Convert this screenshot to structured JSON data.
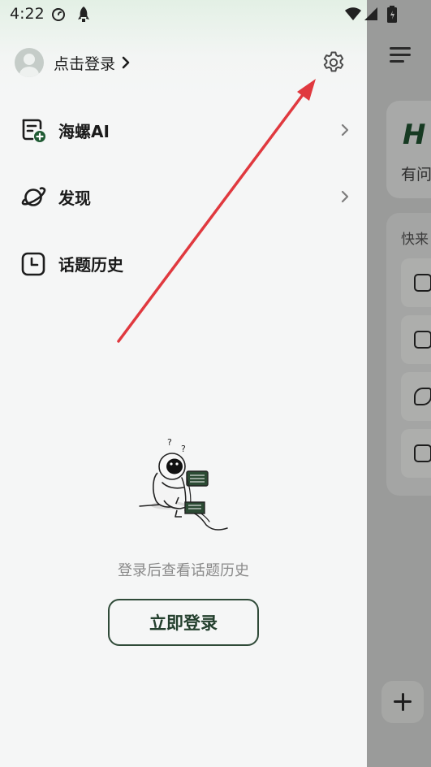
{
  "status_bar": {
    "time": "4:22",
    "icons": [
      "notification-swirl-icon",
      "rocket-icon",
      "wifi-icon",
      "signal-icon",
      "battery-icon"
    ]
  },
  "drawer": {
    "profile": {
      "login_prompt": "点击登录",
      "avatar_icon": "default-avatar-icon",
      "settings_icon": "gear-icon"
    },
    "menu_items": [
      {
        "label": "海螺AI",
        "icon": "chat-plus-icon",
        "has_chevron": true
      },
      {
        "label": "发现",
        "icon": "planet-icon",
        "has_chevron": true
      },
      {
        "label": "话题历史",
        "icon": "clock-icon",
        "has_chevron": false
      }
    ],
    "empty_state": {
      "illustration": "astronaut-reading-illustration",
      "message": "登录后查看话题历史",
      "login_button": "立即登录"
    }
  },
  "background_app": {
    "menu_icon": "hamburger-menu-icon",
    "logo_fragment": "H",
    "subtitle_fragment": "有问",
    "quick_section_fragment": "快来",
    "add_button_icon": "plus-icon"
  },
  "colors": {
    "accent_dark_green": "#24402e",
    "drawer_background": "#f5f6f6",
    "overlay_dim": "#9a9b9a",
    "annotation_arrow": "#e0393f"
  }
}
